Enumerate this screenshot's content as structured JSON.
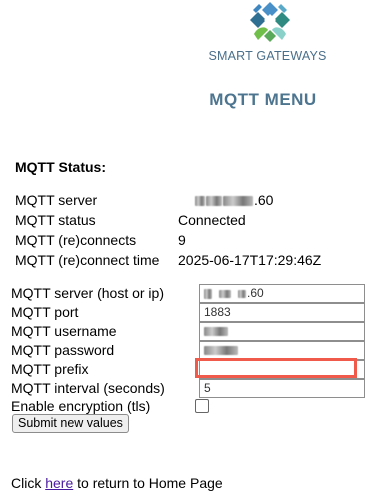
{
  "brand": {
    "name": "SMART GATEWAYS",
    "logo_icon": "four-diamond-logo-icon",
    "colors": [
      "#4a90c8",
      "#2f8a82",
      "#6fbf4a",
      "#8ad1c9"
    ]
  },
  "page": {
    "title": "MQTT MENU"
  },
  "status": {
    "heading": "MQTT Status:",
    "rows": [
      {
        "label": "MQTT server",
        "value": ".60",
        "blurred": true
      },
      {
        "label": "MQTT status",
        "value": "Connected"
      },
      {
        "label": "MQTT (re)connects",
        "value": "9"
      },
      {
        "label": "MQTT (re)connect time",
        "value": "2025-06-17T17:29:46Z"
      }
    ]
  },
  "form": {
    "fields": [
      {
        "label": "MQTT server (host or ip)",
        "value": ".60",
        "blurred": true
      },
      {
        "label": "MQTT port",
        "value": "1883"
      },
      {
        "label": "MQTT username",
        "value": "",
        "blurred": true
      },
      {
        "label": "MQTT password",
        "value": "",
        "blurred": true
      },
      {
        "label": "MQTT prefix",
        "value": "",
        "highlighted": true,
        "highlight_color": "#f05a4a"
      },
      {
        "label": "MQTT interval (seconds)",
        "value": "5"
      }
    ],
    "tls": {
      "label": "Enable encryption (tls)",
      "checked": false
    },
    "submit_label": "Submit new values"
  },
  "footer": {
    "prefix": "Click ",
    "link_text": "here",
    "suffix": " to return to Home Page"
  }
}
